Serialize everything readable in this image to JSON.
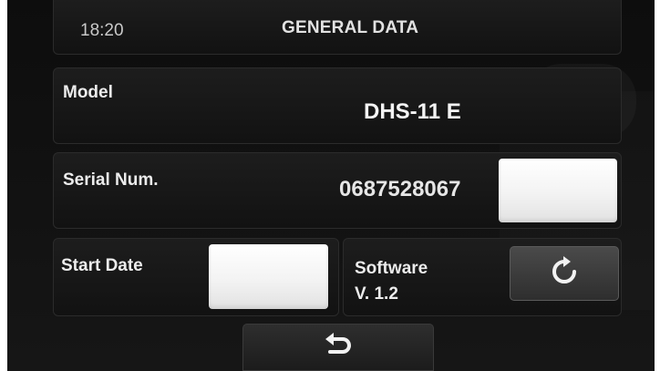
{
  "header": {
    "time": "18:20",
    "title": "GENERAL DATA"
  },
  "model": {
    "label": "Model",
    "value": "DHS-11 E"
  },
  "serial": {
    "label": "Serial Num.",
    "value": "0687528067"
  },
  "start_date": {
    "label": "Start Date",
    "value": ""
  },
  "software": {
    "label_line1": "Software",
    "label_line2": "V. 1.2"
  },
  "icons": {
    "refresh": "refresh-icon",
    "back": "back-arrow-icon"
  },
  "colors": {
    "background": "#111111",
    "panel": "#1a1a1a",
    "text": "#ececec",
    "button_white": "#f4f4f4"
  }
}
